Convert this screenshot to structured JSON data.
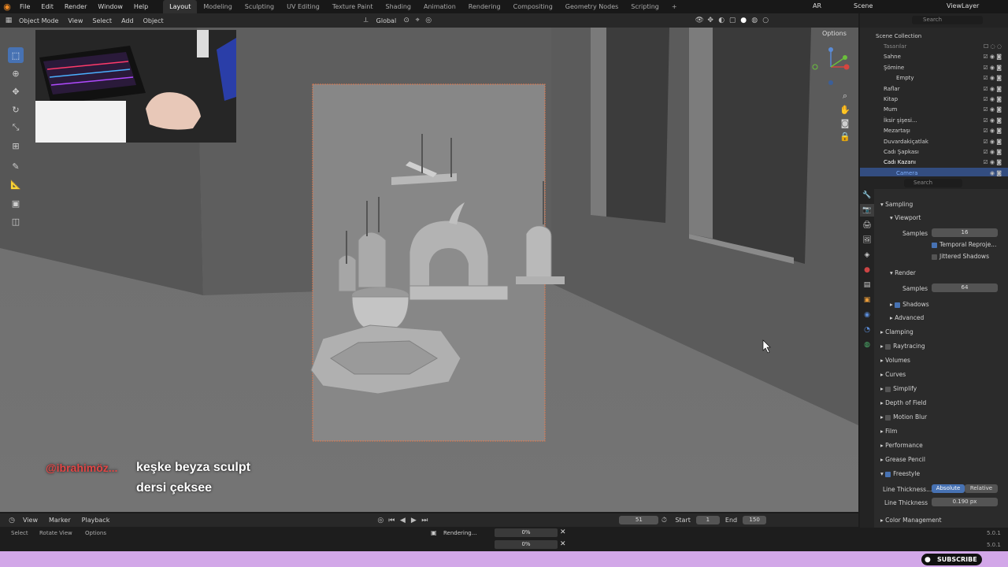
{
  "menu": [
    "File",
    "Edit",
    "Render",
    "Window",
    "Help"
  ],
  "workspaces": [
    "Layout",
    "Modeling",
    "Sculpting",
    "UV Editing",
    "Texture Paint",
    "Shading",
    "Animation",
    "Rendering",
    "Compositing",
    "Geometry Nodes",
    "Scripting"
  ],
  "active_workspace": "Layout",
  "top_right": {
    "lang": "AR",
    "scene": "Scene",
    "view_layer": "ViewLayer"
  },
  "viewport_header": {
    "mode": "Object Mode",
    "view": "View",
    "select": "Select",
    "add": "Add",
    "object": "Object",
    "orientation": "Global",
    "options": "Options"
  },
  "outliner": {
    "search_placeholder": "Search",
    "title": "Scene Collection",
    "items": [
      "Tasarılar",
      "Sahne",
      "Şömine",
      "Empty",
      "Raflar",
      "Kitap",
      "Mum",
      "İksir şişesi...",
      "Mezartaşı",
      "Duvardakiçatlak",
      "Cadı Şapkası",
      "Cadı Kazanı",
      "Camera"
    ]
  },
  "properties": {
    "search_placeholder": "Search",
    "sampling": "Sampling",
    "viewport": "Viewport",
    "samples_label": "Samples",
    "viewport_samples": "16",
    "temporal": "Temporal Reproje...",
    "jittered": "Jittered Shadows",
    "render": "Render",
    "render_samples": "64",
    "shadows": "Shadows",
    "advanced": "Advanced",
    "clamping": "Clamping",
    "raytracing": "Raytracing",
    "volumes": "Volumes",
    "curves": "Curves",
    "simplify": "Simplify",
    "dof": "Depth of Field",
    "motion_blur": "Motion Blur",
    "film": "Film",
    "performance": "Performance",
    "grease_pencil": "Grease Pencil",
    "freestyle": "Freestyle",
    "line_thickness_mode": "Line Thickness...",
    "absolute": "Absolute",
    "relative": "Relative",
    "line_thickness": "Line Thickness",
    "line_thickness_value": "0.190 px",
    "color_management": "Color Management"
  },
  "timeline": {
    "view": "View",
    "marker": "Marker",
    "playback": "Playback",
    "frame": "51",
    "start_label": "Start",
    "start": "1",
    "end_label": "End",
    "end": "150"
  },
  "status": {
    "select": "Select",
    "rotate": "Rotate View",
    "options": "Options",
    "rendering": "Rendering...",
    "progress1": "0%",
    "progress2": "0%",
    "version": "5.0.1",
    "version2": "5.0.1"
  },
  "chat": {
    "user": "@ibrahimöz...",
    "message_line1": "keşke beyza sculpt",
    "message_line2": "dersi çeksee"
  },
  "subscribe": "SUBSCRIBE",
  "colors": {
    "accent": "#4772b3",
    "camera_frame": "#e07a4f",
    "bottom_bar": "#d2a7e8"
  }
}
